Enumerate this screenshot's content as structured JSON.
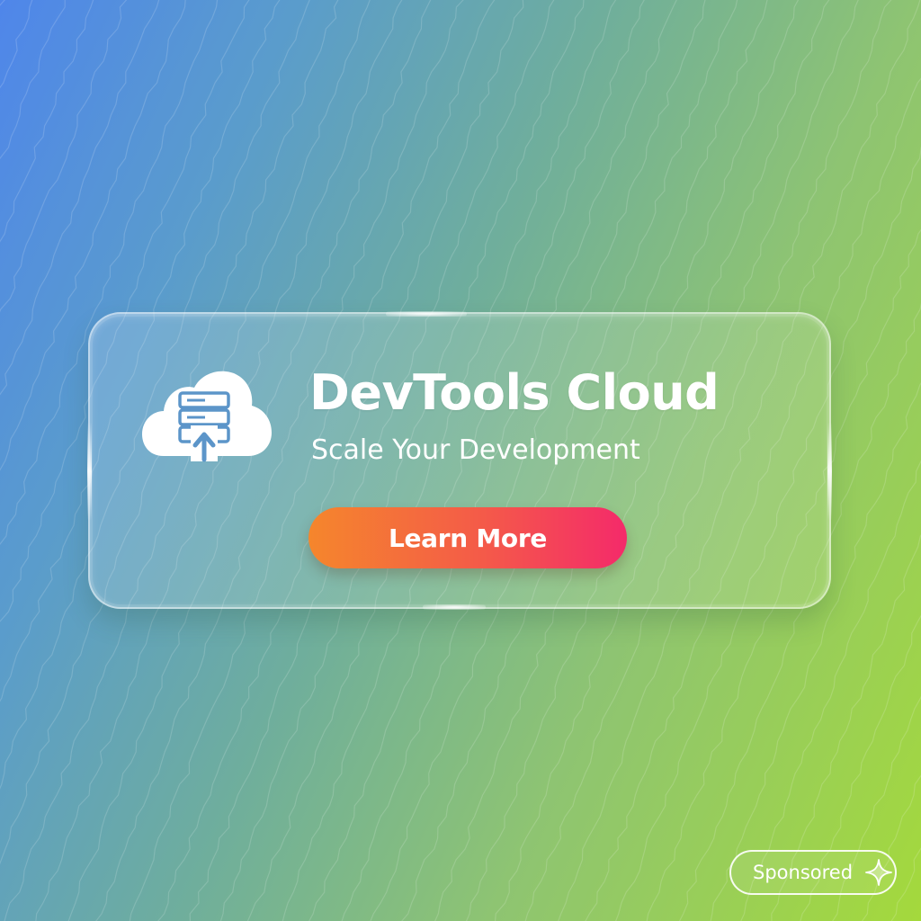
{
  "ad": {
    "title": "DevTools Cloud",
    "subtitle": "Scale Your Development",
    "cta_label": "Learn More",
    "sponsored_label": "Sponsored",
    "icon": "cloud-server-upload-icon",
    "badge_icon": "sparkle-icon"
  },
  "colors": {
    "gradient_start": "#4f86ea",
    "gradient_end": "#a4d93c",
    "cta_start": "#f5862c",
    "cta_end": "#f42a6a",
    "text": "#ffffff"
  }
}
